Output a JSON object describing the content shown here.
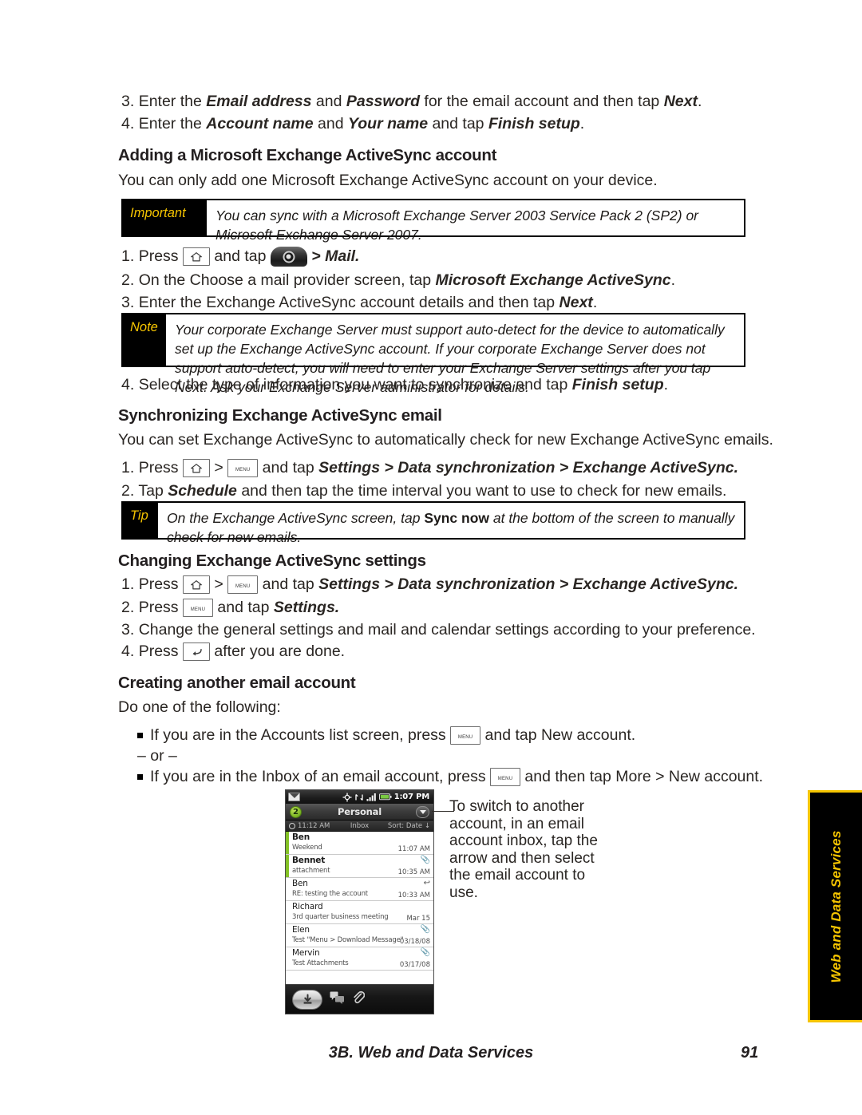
{
  "steps_top": [
    {
      "num": "3.",
      "pre": "Enter the ",
      "b1": "Email address",
      "mid1": " and ",
      "b2": "Password",
      "mid2": " for the email account and then tap ",
      "b3": "Next",
      "post": "."
    },
    {
      "num": "4.",
      "pre": "Enter the ",
      "b1": "Account name",
      "mid1": " and ",
      "b2": "Your name",
      "mid2": " and tap ",
      "b3": "Finish setup",
      "post": "."
    }
  ],
  "section_exchange": {
    "heading": "Adding a Microsoft Exchange ActiveSync account",
    "intro": "You can only add one Microsoft Exchange ActiveSync account on your device.",
    "important": {
      "label": "Important",
      "text": "You can sync with a Microsoft Exchange Server 2003 Service Pack 2 (SP2) or Microsoft Exchange Server 2007."
    },
    "step1": {
      "num": "1.",
      "press": "Press",
      "and_tap": "and tap",
      "tail": "> Mail."
    },
    "step2": {
      "num": "2.",
      "pre": "On the Choose a mail provider screen, tap ",
      "bold": "Microsoft Exchange ActiveSync",
      "post": "."
    },
    "step3": {
      "num": "3.",
      "pre": "Enter the Exchange ActiveSync account details and then tap ",
      "bold": "Next",
      "post": "."
    },
    "note": {
      "label": "Note",
      "text": "Your corporate Exchange Server must support auto-detect for the device to automatically set up the Exchange ActiveSync account. If your corporate Exchange Server does not support auto-detect, you will need to enter your Exchange Server settings after you tap Next. Ask your Exchange Server administrator for details."
    },
    "step4": {
      "num": "4.",
      "pre": "Select the type of information you want to synchronize and tap ",
      "bold": "Finish setup",
      "post": "."
    }
  },
  "section_sync": {
    "heading": "Synchronizing Exchange ActiveSync email",
    "intro": "You can set Exchange ActiveSync to automatically check for new Exchange ActiveSync emails.",
    "step1": {
      "num": "1.",
      "press": "Press",
      "gt": ">",
      "and_tap": "and tap",
      "tail": "Settings > Data synchronization > Exchange ActiveSync."
    },
    "step2": {
      "num": "2.",
      "pre": "Tap ",
      "bold": "Schedule",
      "post": " and then tap the time interval you want to use to check for new emails."
    },
    "tip": {
      "label": "Tip",
      "pre": "On the Exchange ActiveSync screen, tap ",
      "bold": "Sync now",
      "post": " at the bottom of the screen to manually check for new emails."
    }
  },
  "section_settings": {
    "heading": "Changing Exchange ActiveSync settings",
    "step1": {
      "num": "1.",
      "press": "Press",
      "gt": ">",
      "and_tap": "and tap",
      "tail": "Settings > Data synchronization > Exchange ActiveSync."
    },
    "step2": {
      "num": "2.",
      "press": "Press",
      "and_tap": "and tap",
      "tail": "Settings."
    },
    "step3": {
      "num": "3.",
      "text": "Change the general settings and mail and calendar settings according to your preference."
    },
    "step4": {
      "num": "4.",
      "press": "Press",
      "tail": "after you are done."
    }
  },
  "section_create": {
    "heading": "Creating another email account",
    "intro": "Do one of the following:",
    "bullet1": {
      "pre": "If you are in the Accounts list screen, press",
      "mid": "and tap",
      "bold": "New account",
      "post": "."
    },
    "or": "– or –",
    "bullet2": {
      "pre": "If you are in the Inbox of an email account, press",
      "mid": "and then tap",
      "bold": "More > New account",
      "post": "."
    }
  },
  "callout": {
    "text": "To switch to another account, in an email account inbox, tap the arrow and then select the email account to use."
  },
  "phone": {
    "status": {
      "clock": "1:07 PM"
    },
    "title": {
      "badge": "2",
      "account": "Personal"
    },
    "subbar": {
      "time": "11:12 AM",
      "folder": "Inbox",
      "sort": "Sort: Date ↓"
    },
    "emails": [
      {
        "sender": "Ben",
        "subject": "Weekend",
        "time": "11:07 AM",
        "unread": true,
        "mark": ""
      },
      {
        "sender": "Bennet",
        "subject": "attachment",
        "time": "10:35 AM",
        "unread": true,
        "mark": "📎"
      },
      {
        "sender": "Ben",
        "subject": "RE: testing the account",
        "time": "10:33 AM",
        "unread": false,
        "mark": "←"
      },
      {
        "sender": "Richard",
        "subject": "3rd quarter business meeting",
        "time": "Mar 15",
        "unread": false,
        "mark": ""
      },
      {
        "sender": "Elen",
        "subject": "Test \"Menu > Download Message\"",
        "time": "03/18/08",
        "unread": false,
        "mark": "📎"
      },
      {
        "sender": "Mervin",
        "subject": "Test Attachments",
        "time": "03/17/08",
        "unread": false,
        "mark": "📎"
      }
    ],
    "toolbar": {
      "download": "download-icon",
      "messages": "messages-icon",
      "attach": "paperclip-icon"
    }
  },
  "sidetab": {
    "label": "Web and Data Services",
    "bg": "#000000",
    "accent": "#f5c400"
  },
  "footer": {
    "title": "3B. Web and Data Services",
    "page": "91"
  }
}
